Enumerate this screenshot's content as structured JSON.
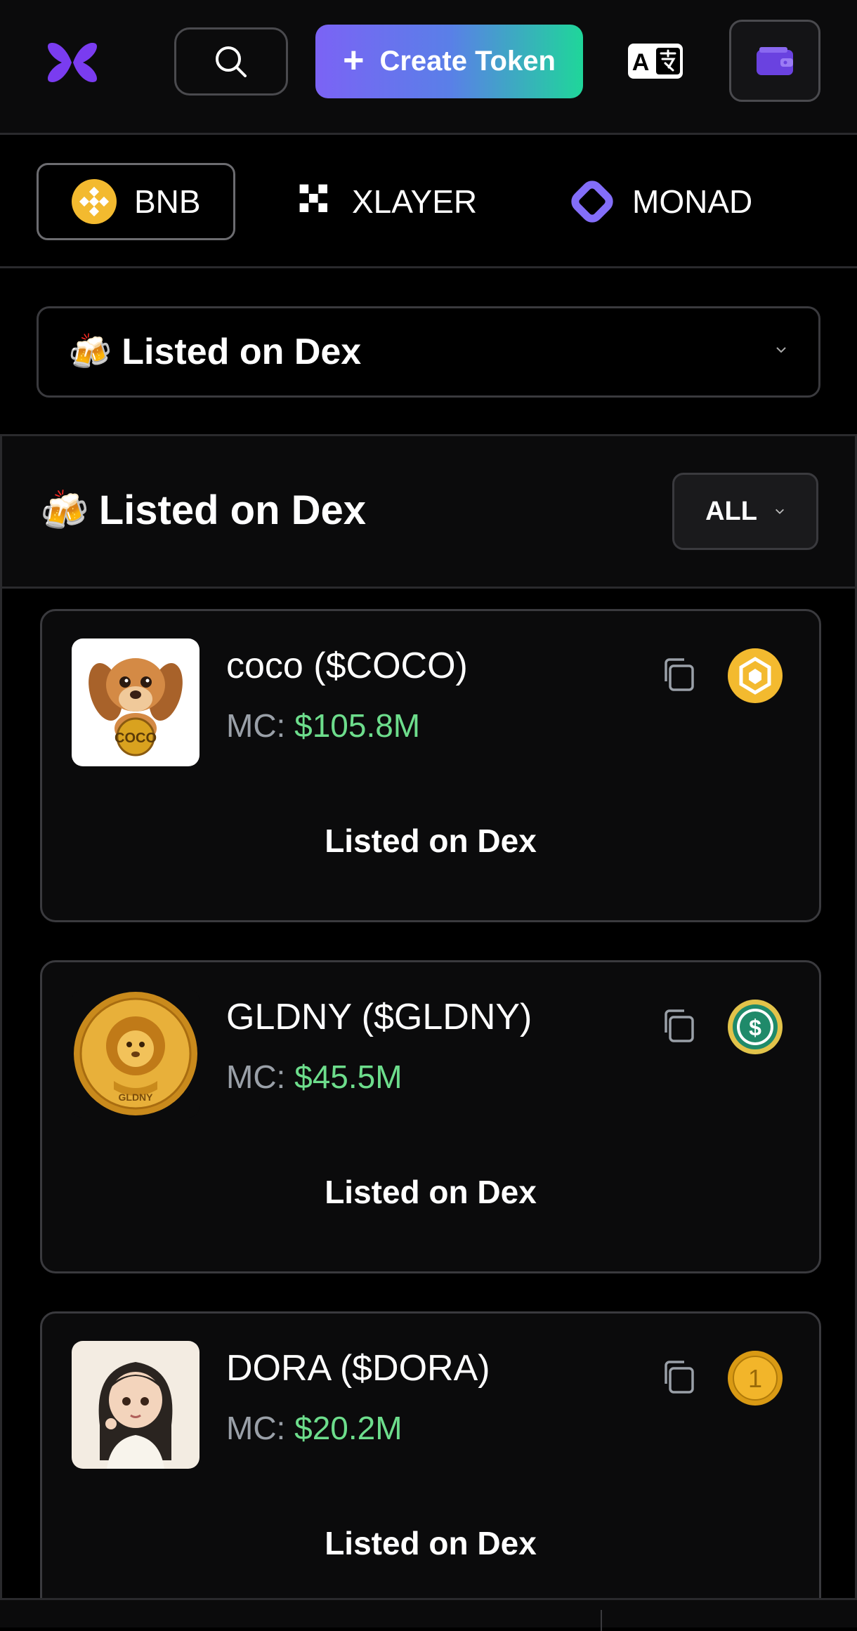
{
  "header": {
    "logo_icon": "butterfly-logo-icon",
    "search_icon": "search-icon",
    "create_button": {
      "icon": "plus-icon",
      "label": "Create Token"
    },
    "language_icon": "translate-icon",
    "wallet_icon": "wallet-icon"
  },
  "chains": [
    {
      "label": "BNB",
      "icon": "bnb-icon",
      "active": true
    },
    {
      "label": "XLAYER",
      "icon": "xlayer-icon",
      "active": false
    },
    {
      "label": "MONAD",
      "icon": "monad-icon",
      "active": false
    }
  ],
  "filter": {
    "emoji": "🍻",
    "selected": "Listed on Dex",
    "chevron_icon": "chevron-down-icon"
  },
  "section": {
    "emoji": "🍻",
    "title": "Listed on Dex",
    "sort_label": "ALL",
    "sort_icon": "chevron-down-icon"
  },
  "tokens": [
    {
      "name": "coco ($COCO)",
      "mc_label": "MC:",
      "mc_value": "$105.8M",
      "status": "Listed on Dex",
      "image": "coco-dog-logo",
      "badge": "bnb-badge-icon"
    },
    {
      "name": "GLDNY ($GLDNY)",
      "mc_label": "MC:",
      "mc_value": "$45.5M",
      "status": "Listed on Dex",
      "image": "gldny-lion-coin-logo",
      "badge": "usd-coin-badge-icon"
    },
    {
      "name": "DORA ($DORA)",
      "mc_label": "MC:",
      "mc_value": "$20.2M",
      "status": "Listed on Dex",
      "image": "dora-girl-logo",
      "badge": "gold-coin-one-badge-icon"
    }
  ],
  "colors": {
    "accent_gradient_start": "#7b63f5",
    "accent_gradient_end": "#1fd69a",
    "market_cap_green": "#6ddd8c",
    "bnb_yellow": "#f3ba2f",
    "monad_purple": "#836ef9"
  }
}
